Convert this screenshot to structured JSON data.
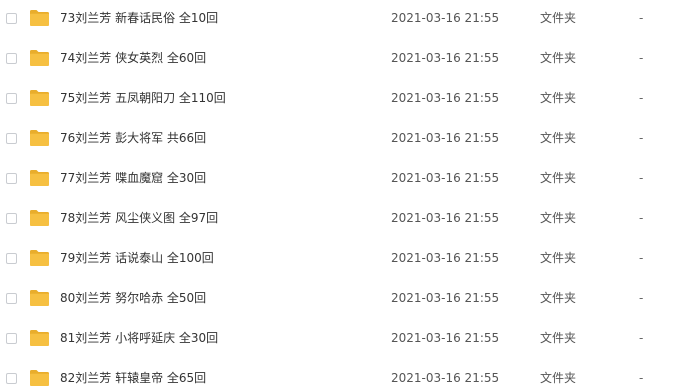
{
  "icon": "folder-icon",
  "colors": {
    "folder": "#f6c042",
    "folder_tab": "#e9ad2c"
  },
  "rows": [
    {
      "name": "73刘兰芳 新春话民俗 全10回",
      "date": "2021-03-16 21:55",
      "type": "文件夹",
      "size": "-"
    },
    {
      "name": "74刘兰芳 侠女英烈 全60回",
      "date": "2021-03-16 21:55",
      "type": "文件夹",
      "size": "-"
    },
    {
      "name": "75刘兰芳 五凤朝阳刀 全110回",
      "date": "2021-03-16 21:55",
      "type": "文件夹",
      "size": "-"
    },
    {
      "name": "76刘兰芳 彭大将军 共66回",
      "date": "2021-03-16 21:55",
      "type": "文件夹",
      "size": "-"
    },
    {
      "name": "77刘兰芳 喋血魔窟 全30回",
      "date": "2021-03-16 21:55",
      "type": "文件夹",
      "size": "-"
    },
    {
      "name": "78刘兰芳 风尘侠义图 全97回",
      "date": "2021-03-16 21:55",
      "type": "文件夹",
      "size": "-"
    },
    {
      "name": "79刘兰芳 话说泰山 全100回",
      "date": "2021-03-16 21:55",
      "type": "文件夹",
      "size": "-"
    },
    {
      "name": "80刘兰芳 努尔哈赤 全50回",
      "date": "2021-03-16 21:55",
      "type": "文件夹",
      "size": "-"
    },
    {
      "name": "81刘兰芳 小将呼延庆 全30回",
      "date": "2021-03-16 21:55",
      "type": "文件夹",
      "size": "-"
    },
    {
      "name": "82刘兰芳 轩辕皇帝 全65回",
      "date": "2021-03-16 21:55",
      "type": "文件夹",
      "size": "-"
    }
  ]
}
